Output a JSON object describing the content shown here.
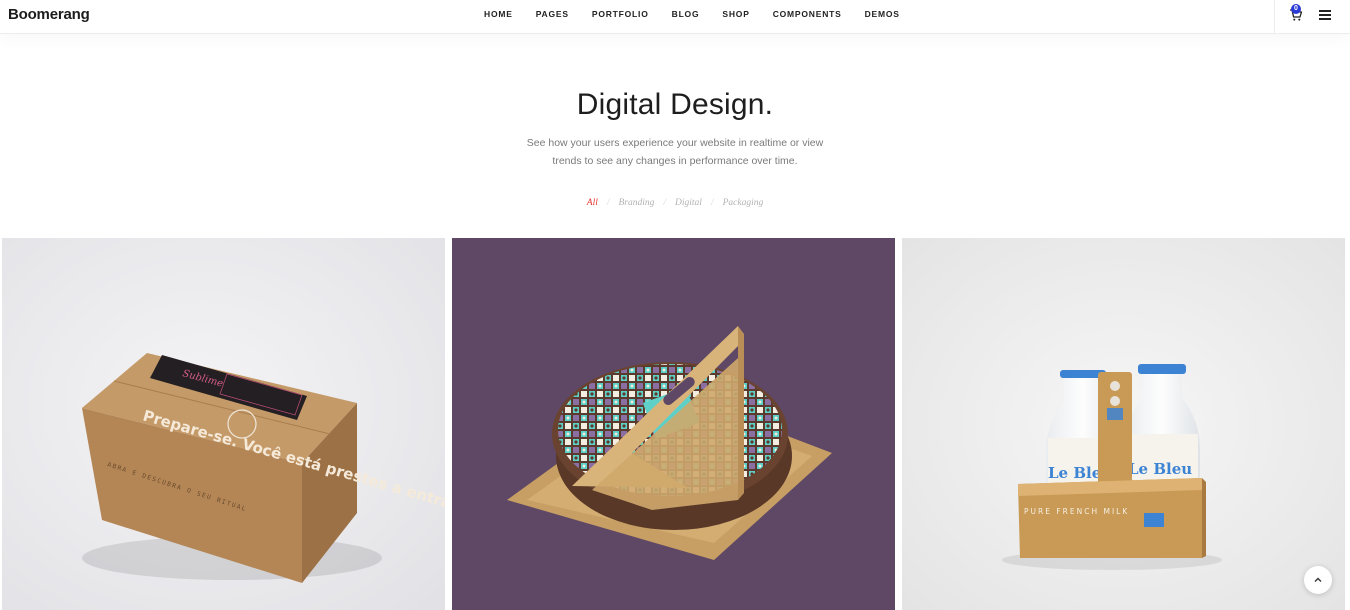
{
  "brand": {
    "logo": "Boomerang"
  },
  "nav": {
    "items": [
      {
        "label": "HOME"
      },
      {
        "label": "PAGES"
      },
      {
        "label": "PORTFOLIO"
      },
      {
        "label": "BLOG"
      },
      {
        "label": "SHOP"
      },
      {
        "label": "COMPONENTS"
      },
      {
        "label": "DEMOS"
      }
    ],
    "cart_count": "0"
  },
  "hero": {
    "title": "Digital Design.",
    "subtitle_line1": "See how your users experience your website in realtime or view",
    "subtitle_line2": "trends to see any changes in performance over time."
  },
  "filters": {
    "items": [
      {
        "label": "All",
        "active": true
      },
      {
        "label": "Branding",
        "active": false
      },
      {
        "label": "Digital",
        "active": false
      },
      {
        "label": "Packaging",
        "active": false
      }
    ],
    "separator": "/"
  },
  "portfolio": {
    "items": [
      {
        "image": "kraft shipping box mockup",
        "box_text": "Prepare-se. Você está prestes a entrar em um universo sublime.",
        "side_text": "ABRA E DESCUBRA O SEU RITUAL",
        "bg": "#ececf0"
      },
      {
        "image": "patterned round cake box with wooden handle",
        "bg": "#5e4866"
      },
      {
        "image": "Le Bleu milk bottles in wooden crate",
        "bottle_label": "Le Bleu",
        "crate_text": "PURE FRENCH MILK",
        "bg": "#efefef"
      }
    ]
  },
  "icons": {
    "cart": "cart-icon",
    "menu": "hamburger-menu-icon",
    "scroll_top": "chevron-up-icon"
  },
  "colors": {
    "accent": "#e5352f",
    "badge": "#2d3bd6",
    "tile2_bg": "#5e4866"
  }
}
